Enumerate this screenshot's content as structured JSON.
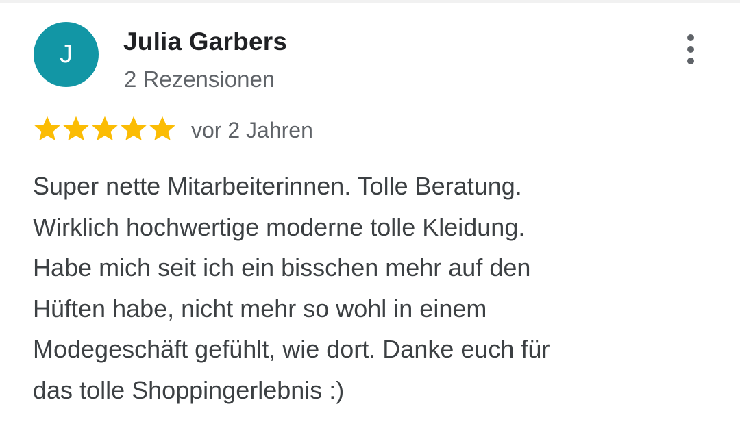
{
  "review": {
    "avatar_letter": "J",
    "avatar_color": "#1296a5",
    "author_name": "Julia Garbers",
    "review_count": "2 Rezensionen",
    "rating": 5,
    "rating_max": 5,
    "star_color": "#fbbc04",
    "time": "vor 2 Jahren",
    "text": "Super nette Mitarbeiterinnen. Tolle Beratung.\nWirklich hochwertige moderne tolle Kleidung.\nHabe mich seit ich ein bisschen mehr auf den\nHüften habe, nicht mehr so wohl in einem\nModegeschäft gefühlt, wie dort. Danke euch für\ndas tolle Shoppingerlebnis :)",
    "more_icon": "more-vert-icon"
  }
}
